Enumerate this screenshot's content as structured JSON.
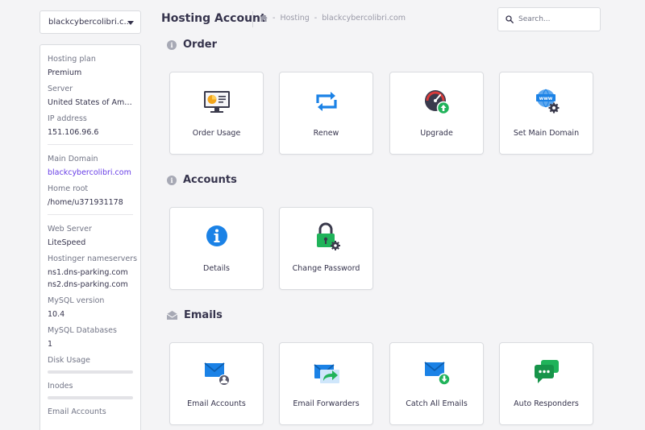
{
  "sidebar": {
    "domain_select": "blackcybercolibri.c...",
    "groups": [
      {
        "items": [
          {
            "label": "Hosting plan",
            "value": "Premium"
          },
          {
            "label": "Server",
            "value": "United States of America"
          },
          {
            "label": "IP address",
            "value": "151.106.96.6"
          }
        ]
      },
      {
        "items": [
          {
            "label": "Main Domain",
            "value": "blackcybercolibri.com"
          },
          {
            "label": "Home root",
            "value": "/home/u371931178"
          }
        ]
      }
    ],
    "web_server_label": "Web Server",
    "web_server_value": "LiteSpeed",
    "nameservers_label": "Hostinger nameservers",
    "nameserver_1": "ns1.dns-parking.com",
    "nameserver_2": "ns2.dns-parking.com",
    "mysql_version_label": "MySQL version",
    "mysql_version_value": "10.4",
    "mysql_db_label": "MySQL Databases",
    "mysql_db_value": "1",
    "disk_usage_label": "Disk Usage",
    "inodes_label": "Inodes",
    "email_accounts_label": "Email Accounts"
  },
  "header": {
    "title": "Hosting Account",
    "breadcrumb_1": "Hosting",
    "breadcrumb_2": "blackcybercolibri.com",
    "separator": "-"
  },
  "search": {
    "placeholder": "Search..."
  },
  "sections": {
    "order": {
      "title": "Order",
      "cards": [
        "Order Usage",
        "Renew",
        "Upgrade",
        "Set Main Domain"
      ]
    },
    "accounts": {
      "title": "Accounts",
      "cards": [
        "Details",
        "Change Password"
      ]
    },
    "emails": {
      "title": "Emails",
      "cards": [
        "Email Accounts",
        "Email Forwarders",
        "Catch All Emails",
        "Auto Responders"
      ]
    }
  },
  "colors": {
    "accent": "#673de6",
    "icon_blue": "#1b82e6",
    "icon_green": "#20b35a",
    "background": "#f4f4f6"
  }
}
